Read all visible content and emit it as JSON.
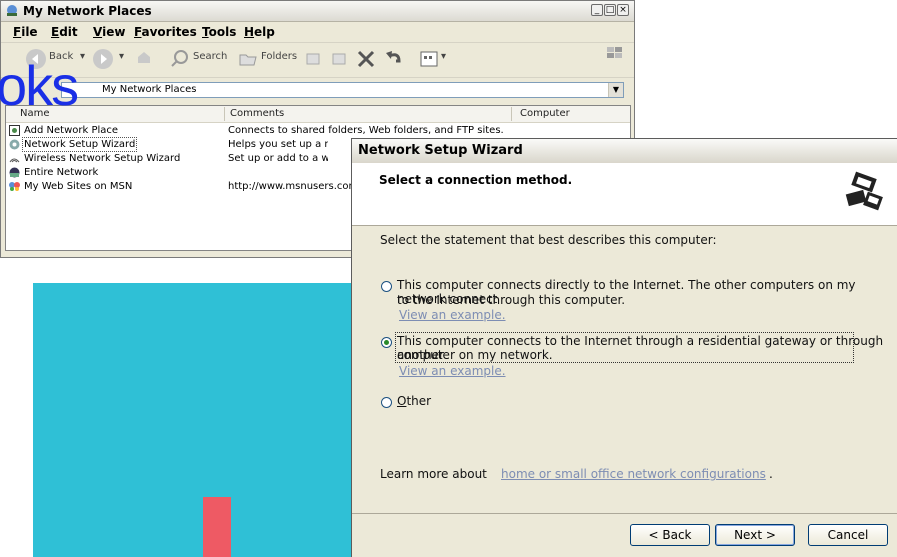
{
  "explorer": {
    "title": "My Network Places",
    "menu": [
      "File",
      "Edit",
      "View",
      "Favorites",
      "Tools",
      "Help"
    ],
    "toolbar": {
      "back": "Back",
      "search": "Search",
      "folders": "Folders"
    },
    "address": "My Network Places",
    "columns": [
      "Name",
      "Comments",
      "Computer"
    ],
    "rows": [
      {
        "name": "Add Network Place",
        "comment": "Connects to shared folders, Web folders, and FTP sites."
      },
      {
        "name": "Network Setup Wizard",
        "comment": "Helps you set up a network fo"
      },
      {
        "name": "Wireless Network Setup Wizard",
        "comment": "Set up or add to a wireless ne"
      },
      {
        "name": "Entire Network",
        "comment": ""
      },
      {
        "name": "My Web Sites on MSN",
        "comment": "http://www.msnusers.com/"
      }
    ]
  },
  "overlay_text": "oks",
  "wizard": {
    "title": "Network Setup Wizard",
    "heading": "Select a connection method.",
    "prompt": "Select the statement that best describes this computer:",
    "option1_line1": "This computer connects directly to the Internet. The other computers on my network connect",
    "option1_line2": "to the Internet through this computer.",
    "option1_link": "View an example.",
    "option2_line1": "This computer connects to the Internet through a residential gateway or through another",
    "option2_line2": "computer on my network.",
    "option2_link": "View an example.",
    "option3": "Other",
    "learn_prefix": "Learn more about",
    "learn_link": "home or small office network configurations",
    "learn_suffix": ".",
    "btn_back": "< Back",
    "btn_next": "Next >",
    "btn_cancel": "Cancel",
    "selected_option": 2
  },
  "colors": {
    "teal": "#2fc0d6",
    "red": "#ee5a64",
    "overlay_blue": "#1a2fe6",
    "link": "#7d8db3"
  }
}
